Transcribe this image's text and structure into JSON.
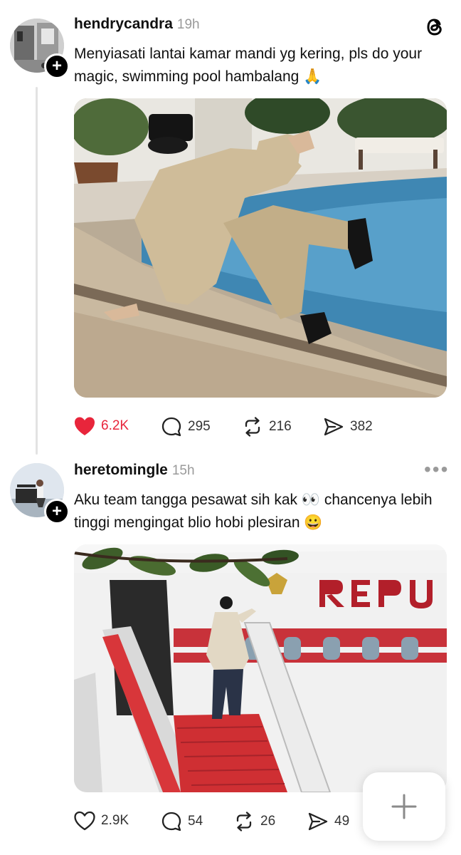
{
  "app": {
    "logo_icon": "threads-logo-icon"
  },
  "posts": [
    {
      "username": "hendrycandra",
      "time": "19h",
      "text": "Menyiasati lantai kamar mandi yg kering, pls do your magic, swimming pool hambalang 🙏",
      "image_icon": "photo-man-slipping-by-pool",
      "liked": true,
      "stats": {
        "likes": "6.2K",
        "replies": "295",
        "reposts": "216",
        "shares": "382"
      }
    },
    {
      "username": "heretomingle",
      "time": "15h",
      "text": "Aku team tangga pesawat sih kak 👀 chancenya lebih tinggi mengingat blio hobi plesiran 😀",
      "image_icon": "photo-man-boarding-plane-stairs",
      "liked": false,
      "stats": {
        "likes": "2.9K",
        "replies": "54",
        "reposts": "26",
        "shares": "49"
      }
    }
  ],
  "colors": {
    "like_active": "#e8253b",
    "muted": "#9a9a9a",
    "text": "#111111"
  }
}
